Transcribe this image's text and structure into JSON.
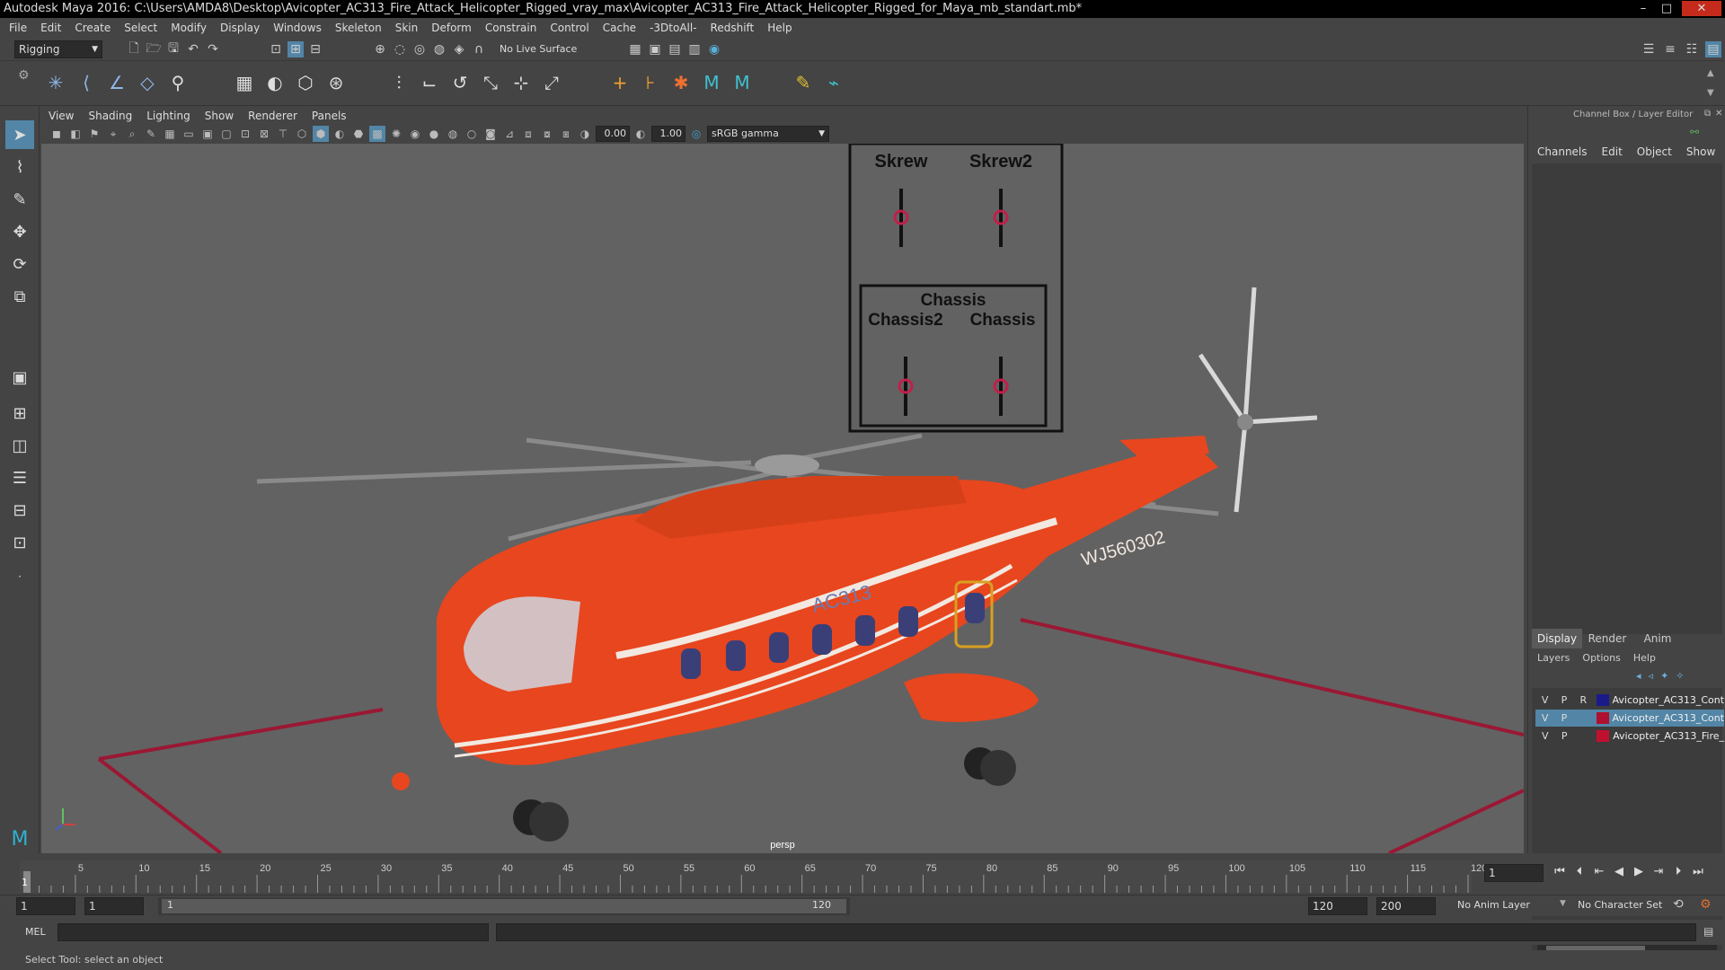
{
  "window": {
    "title": "Autodesk Maya 2016: C:\\Users\\AMDA8\\Desktop\\Avicopter_AC313_Fire_Attack_Helicopter_Rigged_vray_max\\Avicopter_AC313_Fire_Attack_Helicopter_Rigged_for_Maya_mb_standart.mb*",
    "min": "–",
    "max": "□",
    "close": "✕"
  },
  "menu": [
    "File",
    "Edit",
    "Create",
    "Select",
    "Modify",
    "Display",
    "Windows",
    "Skeleton",
    "Skin",
    "Deform",
    "Constrain",
    "Control",
    "Cache",
    "-3DtoAll-",
    "Redshift",
    "Help"
  ],
  "statusline": {
    "mode": "Rigging",
    "live_surface": "No Live Surface"
  },
  "panel_menu": [
    "View",
    "Shading",
    "Lighting",
    "Show",
    "Renderer",
    "Panels"
  ],
  "panel_toolbar": {
    "exposure": "0.00",
    "gamma": "1.00",
    "colorspace": "sRGB gamma"
  },
  "viewport": {
    "camera_label": "persp",
    "rig_labels": {
      "skrew": "Skrew",
      "skrew2": "Skrew2",
      "chassis_top": "Chassis",
      "chassis2": "Chassis2",
      "chassis": "Chassis"
    },
    "fuselage_text": "AC313",
    "tail_text": "WJ560302",
    "colors": {
      "body": "#e8461e",
      "stripe": "#f2e8e0",
      "grid": "#9a1834",
      "control": "#c0204a"
    }
  },
  "right_panel": {
    "header": "Channel Box / Layer Editor",
    "channel_tabs": [
      "Channels",
      "Edit",
      "Object",
      "Show"
    ],
    "layer_tabs": [
      "Display",
      "Render",
      "Anim"
    ],
    "layer_menu": [
      "Layers",
      "Options",
      "Help"
    ],
    "layers": [
      {
        "v": "V",
        "p": "P",
        "r": "R",
        "color": "#1a1a8a",
        "name": "Avicopter_AC313_Cont",
        "selected": false
      },
      {
        "v": "V",
        "p": "P",
        "r": "",
        "color": "#b01030",
        "name": "Avicopter_AC313_Cont",
        "selected": true
      },
      {
        "v": "V",
        "p": "P",
        "r": "",
        "color": "#c01030",
        "name": "Avicopter_AC313_Fire_",
        "selected": false
      }
    ]
  },
  "timeline": {
    "ticks": [
      5,
      10,
      15,
      20,
      25,
      30,
      35,
      40,
      45,
      50,
      55,
      60,
      65,
      70,
      75,
      80,
      85,
      90,
      95,
      100,
      105,
      110,
      115,
      120
    ],
    "start_label": "1",
    "current_frame": "1",
    "max": 120
  },
  "range": {
    "start": "1",
    "inner_start": "1",
    "slider_start": "1",
    "slider_end": "120",
    "end": "120",
    "max_end": "200",
    "anim_layer": "No Anim Layer",
    "character_set": "No Character Set"
  },
  "command": {
    "label": "MEL"
  },
  "help_line": "Select Tool: select an object"
}
